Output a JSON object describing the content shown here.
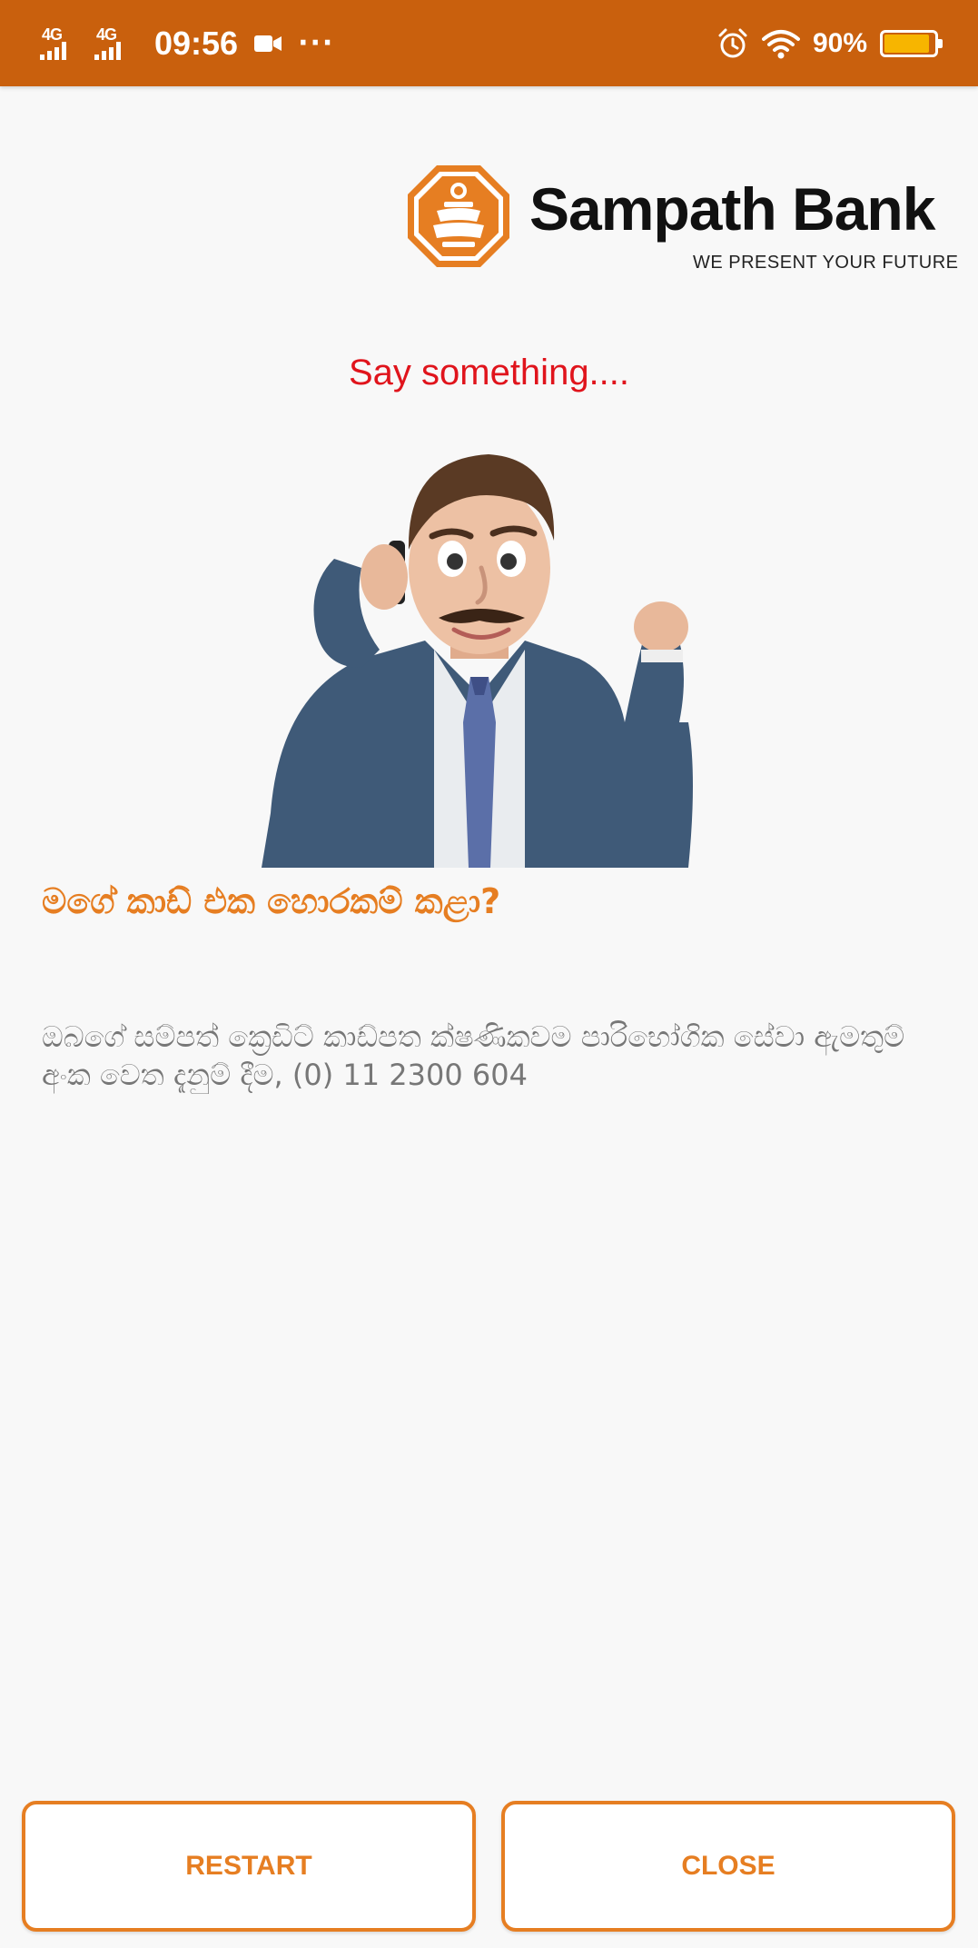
{
  "status_bar": {
    "network_1": "4G",
    "network_2": "4G",
    "time": "09:56",
    "more": "···",
    "battery_percent": "90%",
    "battery_level": 0.9,
    "icons": [
      "signal-icon",
      "signal-icon",
      "video-recording-icon",
      "alarm-icon",
      "wifi-icon",
      "battery-icon"
    ]
  },
  "logo": {
    "name": "Sampath Bank",
    "tagline": "WE PRESENT YOUR FUTURE"
  },
  "prompt": "Say something....",
  "question": "මගේ කාඩ් එක හොරකම් කළා?",
  "answer": "ඔබගේ සම්පත් ක්‍රෙඩිට් කාඩ්පත ක්ෂණිකවම පාරිභෝගික සේවා ඇමතුම් අංක වෙත දැනුම් දීම, (0) 11 2300 604",
  "buttons": {
    "restart": "RESTART",
    "close": "CLOSE"
  },
  "colors": {
    "status_bar": "#c9600d",
    "accent": "#e67e22",
    "prompt": "#e0141c"
  }
}
